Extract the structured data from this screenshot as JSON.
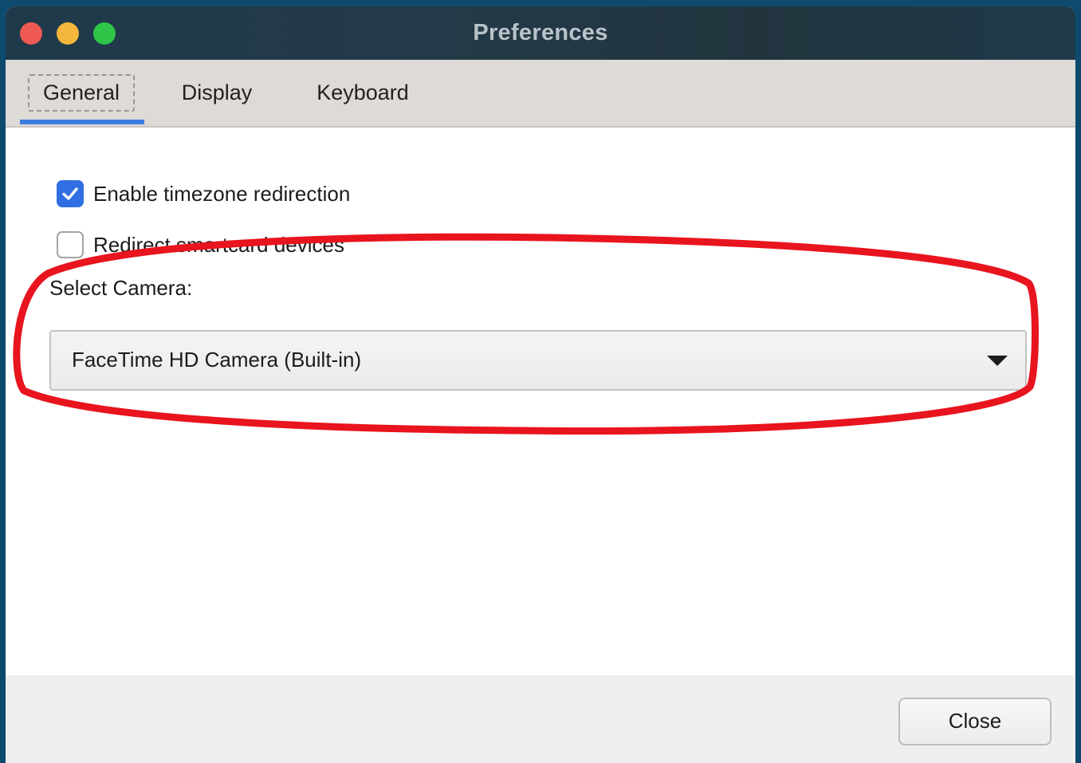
{
  "window": {
    "title": "Preferences"
  },
  "tabs": [
    {
      "label": "General",
      "selected": true
    },
    {
      "label": "Display",
      "selected": false
    },
    {
      "label": "Keyboard",
      "selected": false
    }
  ],
  "general": {
    "timezone_checkbox": {
      "label": "Enable timezone redirection",
      "checked": true
    },
    "smartcard_checkbox": {
      "label": "Redirect smartcard devices",
      "checked": false
    },
    "camera": {
      "label": "Select Camera:",
      "selected": "FaceTime HD Camera (Built-in)"
    }
  },
  "footer": {
    "close_label": "Close"
  },
  "colors": {
    "accent": "#2f6fe3",
    "annotation": "#e8141e"
  },
  "icons": {
    "checked": "checkmark-icon",
    "dropdown": "triangle-down-icon"
  }
}
